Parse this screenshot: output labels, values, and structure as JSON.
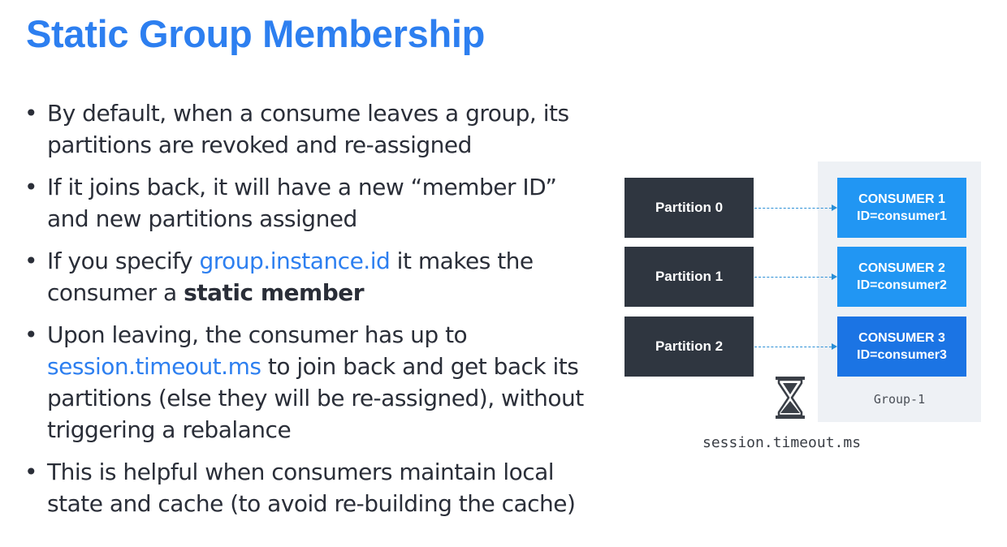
{
  "slide": {
    "title": "Static Group Membership",
    "bullets": [
      {
        "parts": [
          "By default, when a consume leaves a group, its partitions are revoked and re-assigned"
        ]
      },
      {
        "parts": [
          "If it joins back, it will have a new “member ID” and new partitions assigned"
        ]
      },
      {
        "pre": "If you specify ",
        "highlight": "group.instance.id",
        "mid": " it makes the consumer a ",
        "bold": "static member"
      },
      {
        "highlight": "session.timeout.ms",
        "post": " to join back and get back its partitions (else they will be re-assigned), without triggering a rebalance",
        "pre": "Upon leaving, the consumer has up to "
      },
      {
        "parts": [
          "This is helpful when consumers maintain local state and cache (to avoid re-building the cache)"
        ]
      }
    ]
  },
  "diagram": {
    "partitions": [
      "Partition 0",
      "Partition 1",
      "Partition 2"
    ],
    "consumers": [
      {
        "name": "CONSUMER 1",
        "id": "ID=consumer1"
      },
      {
        "name": "CONSUMER 2",
        "id": "ID=consumer2"
      },
      {
        "name": "CONSUMER 3",
        "id": "ID=consumer3"
      }
    ],
    "group_label": "Group-1",
    "timeout_label": "session.timeout.ms",
    "icons": {
      "timer": "hourglass-icon"
    },
    "colors": {
      "title": "#2d7ff0",
      "partition": "#2f3640",
      "consumer": "#2196f3",
      "consumer_active": "#1b74e4",
      "arrow": "#2b8fd6"
    }
  }
}
